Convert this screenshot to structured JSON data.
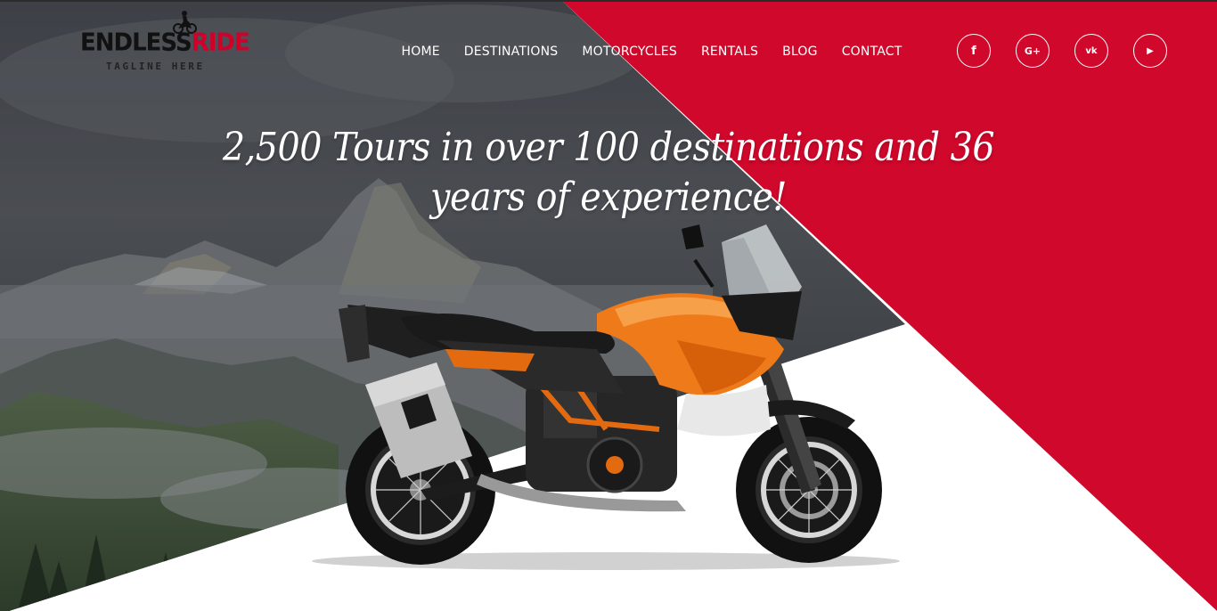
{
  "logo": {
    "word_part1": "ENDLESS",
    "word_part2": "RIDE",
    "tagline": "TAGLINE HERE",
    "icon": "motorbike-rider-icon"
  },
  "nav": {
    "items": [
      {
        "label": "HOME"
      },
      {
        "label": "DESTINATIONS"
      },
      {
        "label": "MOTORCYCLES"
      },
      {
        "label": "RENTALS"
      },
      {
        "label": "BLOG"
      },
      {
        "label": "CONTACT"
      }
    ]
  },
  "socials": [
    {
      "icon": "facebook-icon",
      "glyph": "f"
    },
    {
      "icon": "google-plus-icon",
      "glyph": "G+"
    },
    {
      "icon": "vk-icon",
      "glyph": "vk"
    },
    {
      "icon": "youtube-icon",
      "glyph": "▶"
    }
  ],
  "hero": {
    "headline_line1": "2,500 Tours in over 100 destinations and 36",
    "headline_line2": "years of experience!",
    "image": "orange-adventure-motorcycle"
  },
  "colors": {
    "accent": "#d0082b",
    "dark_overlay": "#3a3d42",
    "text": "#ffffff"
  }
}
